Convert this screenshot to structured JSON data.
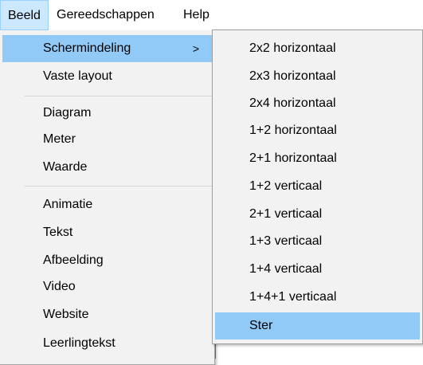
{
  "menubar": {
    "items": [
      {
        "label": "Beeld"
      },
      {
        "label": "Gereedschappen"
      },
      {
        "label": "Help"
      }
    ]
  },
  "beeld_menu": {
    "group1": [
      {
        "label": "Schermindeling",
        "submenu_arrow": ">"
      },
      {
        "label": "Vaste layout"
      }
    ],
    "group2": [
      {
        "label": "Diagram"
      },
      {
        "label": "Meter"
      },
      {
        "label": "Waarde"
      }
    ],
    "group3": [
      {
        "label": "Animatie"
      },
      {
        "label": "Tekst"
      },
      {
        "label": "Afbeelding"
      },
      {
        "label": "Video"
      },
      {
        "label": "Website"
      },
      {
        "label": "Leerlingtekst"
      }
    ]
  },
  "schermindeling_submenu": {
    "items": [
      {
        "label": "2x2 horizontaal"
      },
      {
        "label": "2x3 horizontaal"
      },
      {
        "label": "2x4 horizontaal"
      },
      {
        "label": "1+2 horizontaal"
      },
      {
        "label": "2+1 horizontaal"
      },
      {
        "label": "1+2 verticaal"
      },
      {
        "label": "2+1 verticaal"
      },
      {
        "label": "1+3 verticaal"
      },
      {
        "label": "1+4 verticaal"
      },
      {
        "label": "1+4+1 verticaal"
      },
      {
        "label": "Ster"
      }
    ]
  },
  "colors": {
    "menu_background": "#f2f2f2",
    "highlight": "#91c9f7",
    "menubar_active": "#cce8ff"
  }
}
